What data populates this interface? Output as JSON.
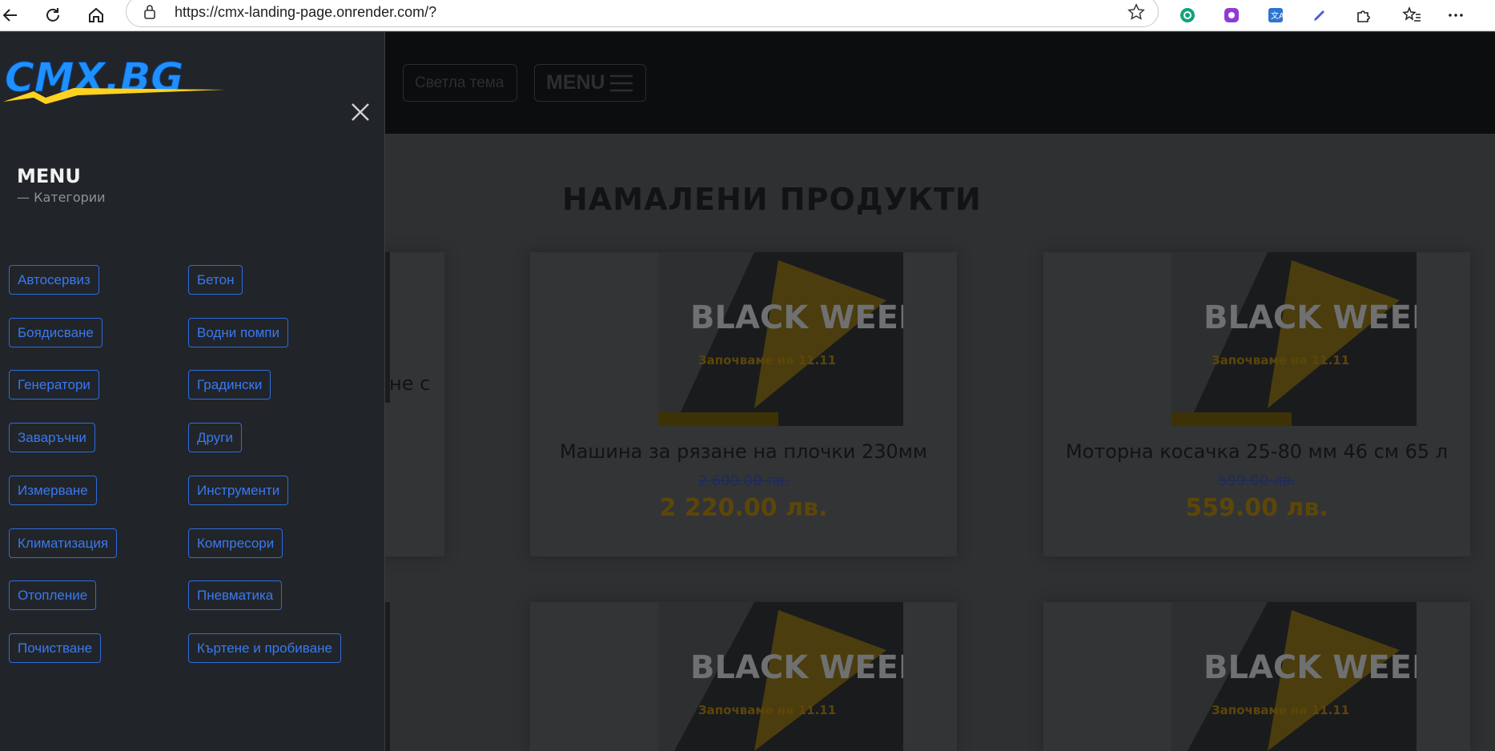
{
  "browser": {
    "url": "https://cmx-landing-page.onrender.com/?",
    "icons": [
      "back-icon",
      "refresh-icon",
      "home-icon",
      "lock-icon",
      "star-icon",
      "chatgpt-icon",
      "extension-purple-icon",
      "translate-icon",
      "pen-icon",
      "puzzle-icon",
      "favorites-icon",
      "more-icon"
    ]
  },
  "header": {
    "theme_label": "Светла тема",
    "menu_label": "MENU"
  },
  "main": {
    "section_title": "НАМАЛЕНИ ПРОДУКТИ",
    "partial_card_text": "не с",
    "products": [
      {
        "title": "Машина за рязане на плочки 230мм",
        "old_price": "2 600.00 лв.",
        "new_price": "2 220.00 лв.",
        "promo_title": "BLACK WEEK",
        "promo_sub": "Започваме на 11.11"
      },
      {
        "title": "Моторна косачка 25-80 мм 46 см 65 л",
        "old_price": "599.00 лв.",
        "new_price": "559.00 лв.",
        "promo_title": "BLACK WEEK",
        "promo_sub": "Започваме на 11.11"
      },
      {
        "title": "",
        "old_price": "",
        "new_price": "",
        "promo_title": "BLACK WEEK",
        "promo_sub": "Започваме на 11.11"
      },
      {
        "title": "",
        "old_price": "",
        "new_price": "",
        "promo_title": "BLACK WEEK",
        "promo_sub": "Започваме на 11.11"
      }
    ]
  },
  "drawer": {
    "logo": "CMX.BG",
    "title": "MENU",
    "subtitle": "— Категории",
    "categories_left": [
      "Автосервиз",
      "Боядисване",
      "Генератори",
      "Заваръчни",
      "Измерване",
      "Климатизация",
      "Отопление",
      "Почистване"
    ],
    "categories_right": [
      "Бетон",
      "Водни помпи",
      "Градински",
      "Други",
      "Инструменти",
      "Компресори",
      "Пневматика",
      "Къртене и пробиване"
    ]
  },
  "colors": {
    "accent_blue": "#2d6be0",
    "price_gold": "#f4b400",
    "drawer_bg": "#212529",
    "logo_blue": "#1e90ff",
    "logo_yellow": "#ffd21f"
  }
}
